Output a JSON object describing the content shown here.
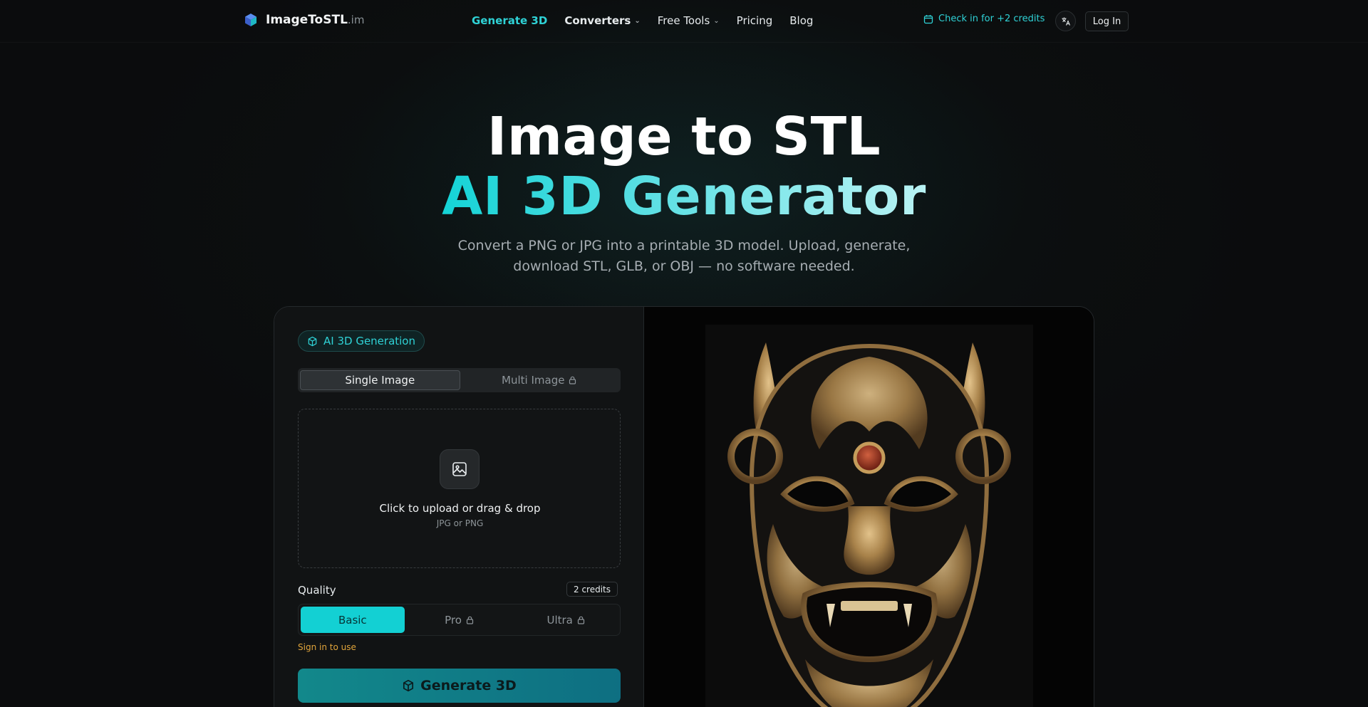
{
  "brand": {
    "name": "ImageToSTL",
    "tld": ".im"
  },
  "nav": {
    "links": [
      {
        "label": "Generate 3D"
      },
      {
        "label": "Converters"
      },
      {
        "label": "Free Tools"
      },
      {
        "label": "Pricing"
      },
      {
        "label": "Blog"
      }
    ],
    "checkin_label": "Check in for +2 credits",
    "lang_icon": "translate-icon",
    "login_label": "Log In"
  },
  "hero": {
    "title_line1": "Image to STL",
    "title_line2": "AI 3D Generator",
    "subtitle": "Convert a PNG or JPG into a printable 3D model. Upload, generate, download STL, GLB, or OBJ — no software needed."
  },
  "generator": {
    "badge_label": "AI 3D Generation",
    "mode_tabs": [
      {
        "label": "Single Image",
        "locked": false,
        "selected": true
      },
      {
        "label": "Multi Image",
        "locked": true,
        "selected": false
      }
    ],
    "upload": {
      "title": "Click to upload or drag & drop",
      "hint": "JPG or PNG"
    },
    "quality": {
      "label": "Quality",
      "credits": "2 credits",
      "options": [
        {
          "label": "Basic",
          "locked": false,
          "selected": true
        },
        {
          "label": "Pro",
          "locked": true,
          "selected": false
        },
        {
          "label": "Ultra",
          "locked": true,
          "selected": false
        }
      ],
      "signin_note": "Sign in to use"
    },
    "generate_label": "Generate 3D"
  },
  "colors": {
    "accent": "#13d0d3",
    "warning": "#e0a43b",
    "background": "#0b0c0d"
  }
}
